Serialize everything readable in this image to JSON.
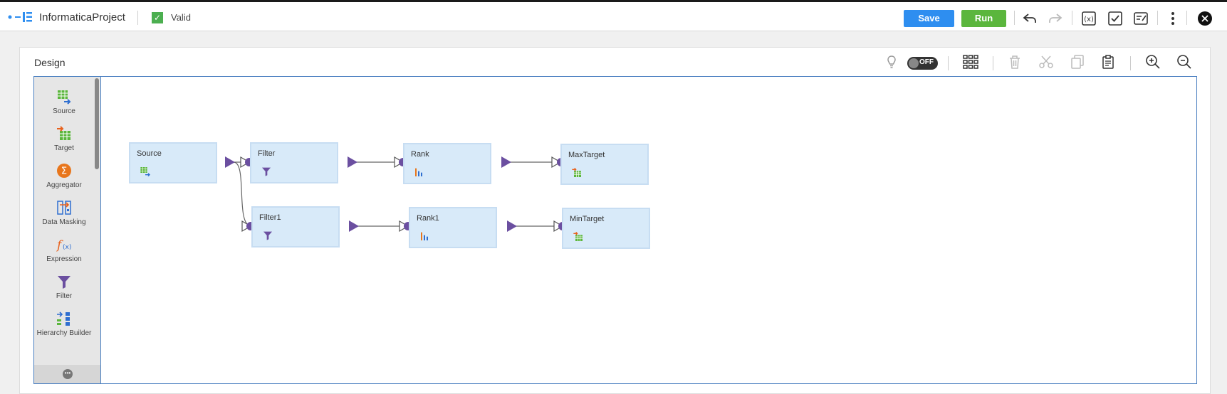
{
  "header": {
    "project_name": "InformaticaProject",
    "status": "Valid",
    "save_label": "Save",
    "run_label": "Run",
    "icons": [
      "undo-icon",
      "redo-icon",
      "parameters-icon",
      "validate-icon",
      "notes-icon",
      "more-icon",
      "close-icon"
    ]
  },
  "design": {
    "title": "Design",
    "toggle_label": "OFF",
    "icons": [
      "lightbulb-icon",
      "arrange-all-icon",
      "delete-icon",
      "cut-icon",
      "copy-icon",
      "paste-icon",
      "zoom-in-icon",
      "zoom-out-icon"
    ]
  },
  "palette": {
    "items": [
      {
        "label": "Source",
        "icon": "source-icon"
      },
      {
        "label": "Target",
        "icon": "target-icon"
      },
      {
        "label": "Aggregator",
        "icon": "aggregator-icon"
      },
      {
        "label": "Data Masking",
        "icon": "data-masking-icon"
      },
      {
        "label": "Expression",
        "icon": "expression-icon"
      },
      {
        "label": "Filter",
        "icon": "filter-icon"
      },
      {
        "label": "Hierarchy Builder",
        "icon": "hierarchy-builder-icon"
      }
    ]
  },
  "mapping": {
    "nodes": [
      {
        "label": "Source",
        "type": "source"
      },
      {
        "label": "Filter",
        "type": "filter"
      },
      {
        "label": "Rank",
        "type": "rank"
      },
      {
        "label": "MaxTarget",
        "type": "target"
      },
      {
        "label": "Filter1",
        "type": "filter"
      },
      {
        "label": "Rank1",
        "type": "rank"
      },
      {
        "label": "MinTarget",
        "type": "target"
      }
    ],
    "links": [
      [
        "Source",
        "Filter"
      ],
      [
        "Source",
        "Filter1"
      ],
      [
        "Filter",
        "Rank"
      ],
      [
        "Rank",
        "MaxTarget"
      ],
      [
        "Filter1",
        "Rank1"
      ],
      [
        "Rank1",
        "MinTarget"
      ]
    ]
  },
  "colors": {
    "accent_blue": "#2e8ef0",
    "run_green": "#5bb63d",
    "port_purple": "#6b4fa0",
    "node_fill": "#d8eaf9",
    "canvas_border": "#4a7fc1"
  }
}
